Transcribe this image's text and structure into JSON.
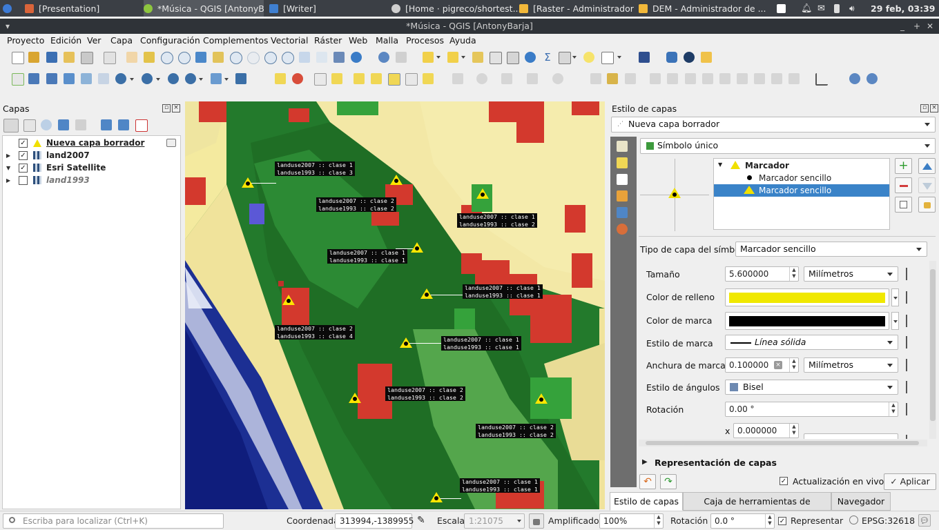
{
  "taskbar": {
    "tasks": [
      "[Presentation]",
      "*Música - QGIS [AntonyB...",
      "[Writer]",
      "[Home · pigreco/shortest...",
      "[Raster - Administrador d...",
      "DEM - Administrador de ..."
    ],
    "clock": "29 feb, 03:39"
  },
  "window": {
    "title": "*Música - QGIS [AntonyBarja]"
  },
  "menu": [
    "Proyecto",
    "Edición",
    "Ver",
    "Capa",
    "Configuración",
    "Complementos",
    "Vectorial",
    "Ráster",
    "Web",
    "Malla",
    "Procesos",
    "Ayuda"
  ],
  "layers_panel": {
    "title": "Capas",
    "layers": [
      {
        "name": "Nueva capa borrador",
        "checked": true
      },
      {
        "name": "land2007",
        "checked": true
      },
      {
        "name": "Esri Satellite",
        "checked": true
      },
      {
        "name": "land1993",
        "checked": false
      }
    ]
  },
  "map": {
    "labels": [
      {
        "l1": "landuse2007 :: clase 1",
        "l2": "landuse1993 :: clase 3"
      },
      {
        "l1": "landuse2007 :: clase 2",
        "l2": "landuse1993 :: clase 2"
      },
      {
        "l1": "landuse2007 :: clase 1",
        "l2": "landuse1993 :: clase 2"
      },
      {
        "l1": "landuse2007 :: clase 1",
        "l2": "landuse1993 :: clase 1"
      },
      {
        "l1": "landuse2007 :: clase 1",
        "l2": "landuse1993 :: clase 1"
      },
      {
        "l1": "landuse2007 :: clase 2",
        "l2": "landuse1993 :: clase 4"
      },
      {
        "l1": "landuse2007 :: clase 1",
        "l2": "landuse1993 :: clase 1"
      },
      {
        "l1": "landuse2007 :: clase 2",
        "l2": "landuse1993 :: clase 2"
      },
      {
        "l1": "landuse2007 :: clase 2",
        "l2": "landuse1993 :: clase 2"
      },
      {
        "l1": "landuse2007 :: clase 1",
        "l2": "landuse1993 :: clase 1"
      }
    ]
  },
  "style_panel": {
    "title": "Estilo de capas",
    "layer_combo": "Nueva capa borrador",
    "renderer": "Símbolo único",
    "tree": {
      "root": "Marcador",
      "items": [
        "Marcador sencillo",
        "Marcador sencillo"
      ]
    },
    "symbol_layer_type_label": "Tipo de capa del símbolo",
    "symbol_layer_type": "Marcador sencillo",
    "props": {
      "size_label": "Tamaño",
      "size": "5.600000",
      "size_unit": "Milímetros",
      "fill_label": "Color de relleno",
      "fill_color": "#f0e800",
      "stroke_label": "Color de marca",
      "stroke_color": "#000000",
      "stroke_style_label": "Estilo de marca",
      "stroke_style": "Línea sólida",
      "stroke_width_label": "Anchura de marca",
      "stroke_width": "0.100000",
      "stroke_width_unit": "Milímetros",
      "join_label": "Estilo de ángulos",
      "join": "Bisel",
      "rotation_label": "Rotación",
      "rotation": "0.00 °",
      "offset_x_label": "x",
      "offset_x": "0.000000"
    },
    "layer_render": "Representación de capas",
    "live_update": "Actualización en vivo",
    "apply": "Aplicar",
    "tabs": [
      "Estilo de capas",
      "Caja de herramientas de Procesos",
      "Navegador"
    ]
  },
  "status": {
    "locator_placeholder": "Escriba para localizar (Ctrl+K)",
    "coord_label": "Coordenada",
    "coord": "313994,-1389955",
    "scale_label": "Escala",
    "scale": "1:21075",
    "magnifier_label": "Amplificador",
    "magnifier": "100%",
    "rotation_label": "Rotación",
    "rotation": "0.0 °",
    "render_label": "Representar",
    "crs": "EPSG:32618"
  }
}
